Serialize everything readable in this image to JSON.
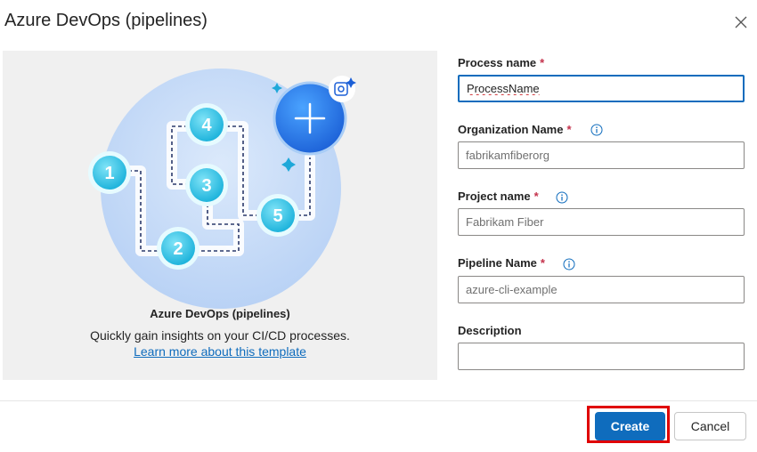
{
  "dialog": {
    "title": "Azure DevOps (pipelines)"
  },
  "template_panel": {
    "heading": "Azure DevOps (pipelines)",
    "description": "Quickly gain insights on your CI/CD processes.",
    "link": "Learn more about this template",
    "steps": [
      "1",
      "2",
      "3",
      "4",
      "5"
    ]
  },
  "form": {
    "process_name": {
      "label": "Process name",
      "required": "*",
      "value": "ProcessName"
    },
    "organization_name": {
      "label": "Organization Name",
      "required": "*",
      "placeholder": "fabrikamfiberorg"
    },
    "project_name": {
      "label": "Project name",
      "required": "*",
      "placeholder": "Fabrikam Fiber"
    },
    "pipeline_name": {
      "label": "Pipeline Name",
      "required": "*",
      "placeholder": "azure-cli-example"
    },
    "description": {
      "label": "Description",
      "value": ""
    }
  },
  "footer": {
    "create_label": "Create",
    "cancel_label": "Cancel"
  },
  "colors": {
    "accent": "#0f6cbd",
    "required": "#c4314b",
    "highlight": "#e00000"
  }
}
